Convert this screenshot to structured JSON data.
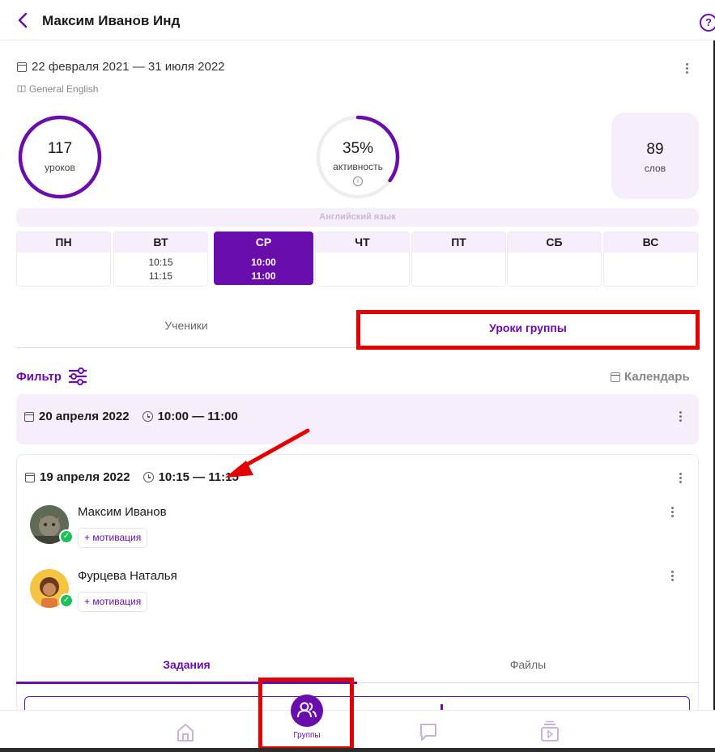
{
  "header": {
    "title": "Максим Иванов Инд",
    "back_icon": "chevron-left-icon",
    "help_label": "?"
  },
  "course": {
    "date_range": "22 февраля 2021 — 31 июля 2022",
    "name": "General English"
  },
  "stats": {
    "lessons": {
      "value": "117",
      "label": "уроков",
      "progress": 1.0
    },
    "activity": {
      "value": "35%",
      "label": "активность",
      "progress": 0.35
    },
    "words": {
      "value": "89",
      "label": "слов"
    }
  },
  "schedule": {
    "language": "Английский язык",
    "days": [
      {
        "label": "ПН",
        "times": []
      },
      {
        "label": "ВТ",
        "times": [
          "10:15",
          "11:15"
        ]
      },
      {
        "label": "СР",
        "times": [
          "10:00",
          "11:00"
        ],
        "active": true
      },
      {
        "label": "ЧТ",
        "times": []
      },
      {
        "label": "ПТ",
        "times": []
      },
      {
        "label": "СБ",
        "times": []
      },
      {
        "label": "ВС",
        "times": []
      }
    ]
  },
  "tabs": {
    "students": "Ученики",
    "group_lessons": "Уроки группы",
    "active": "group_lessons"
  },
  "toolbar": {
    "filter_label": "Фильтр",
    "calendar_label": "Календарь"
  },
  "lessons": [
    {
      "date": "20 апреля 2022",
      "time": "10:00 — 11:00"
    },
    {
      "date": "19 апреля 2022",
      "time": "10:15 — 11:15",
      "students": [
        {
          "name": "Максим Иванов",
          "motivation_label": "+ мотивация",
          "attended": true
        },
        {
          "name": "Фурцева Наталья",
          "motivation_label": "+ мотивация",
          "attended": true
        }
      ],
      "sub_tabs": {
        "tasks": "Задания",
        "files": "Файлы",
        "active": "tasks"
      }
    }
  ],
  "bottom_nav": {
    "items": [
      {
        "name": "home",
        "icon": "home-icon"
      },
      {
        "name": "groups",
        "icon": "users-icon",
        "label": "Группы",
        "active": true
      },
      {
        "name": "chat",
        "icon": "chat-icon"
      },
      {
        "name": "media",
        "icon": "media-icon"
      }
    ]
  },
  "colors": {
    "accent": "#6a0dad",
    "accent_light": "#f7eefb",
    "highlight": "#e50000",
    "success": "#1fbf5b"
  }
}
